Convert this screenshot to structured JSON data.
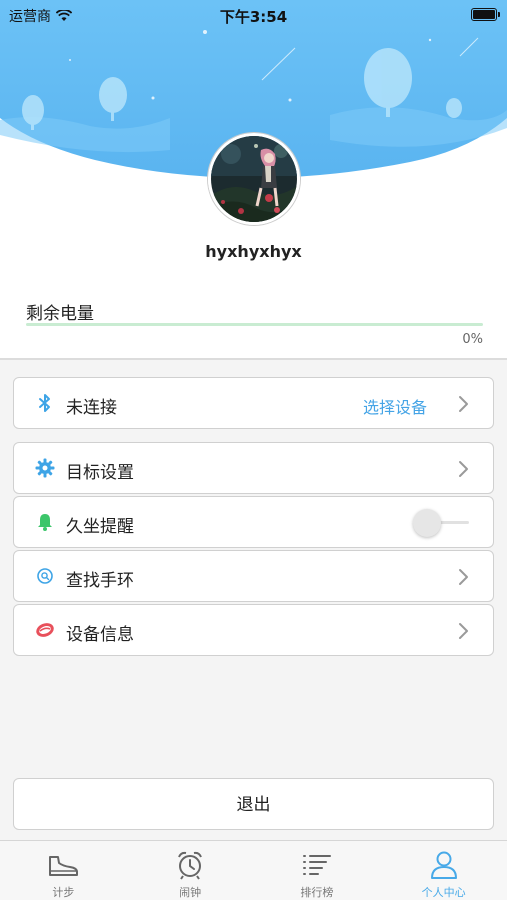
{
  "status_bar": {
    "carrier": "运营商",
    "time": "下午3:54"
  },
  "profile": {
    "username": "hyxhyxhyx"
  },
  "battery": {
    "label": "剩余电量",
    "percent_text": "0%",
    "level": 0.0
  },
  "connection": {
    "status_label": "未连接",
    "action_label": "选择设备"
  },
  "settings": {
    "goal_label": "目标设置",
    "sedentary_label": "久坐提醒",
    "sedentary_enabled": false,
    "find_band_label": "查找手环",
    "device_info_label": "设备信息"
  },
  "logout": {
    "label": "退出"
  },
  "tabbar": {
    "tabs": [
      {
        "label": "计步",
        "icon": "shoe-icon"
      },
      {
        "label": "闹钟",
        "icon": "alarm-clock-icon"
      },
      {
        "label": "排行榜",
        "icon": "ranking-list-icon"
      },
      {
        "label": "个人中心",
        "icon": "person-icon",
        "active": true
      }
    ]
  },
  "colors": {
    "accent": "#47a9e8",
    "sky": "#5fb9f2",
    "battery_green": "#6fd28c"
  }
}
